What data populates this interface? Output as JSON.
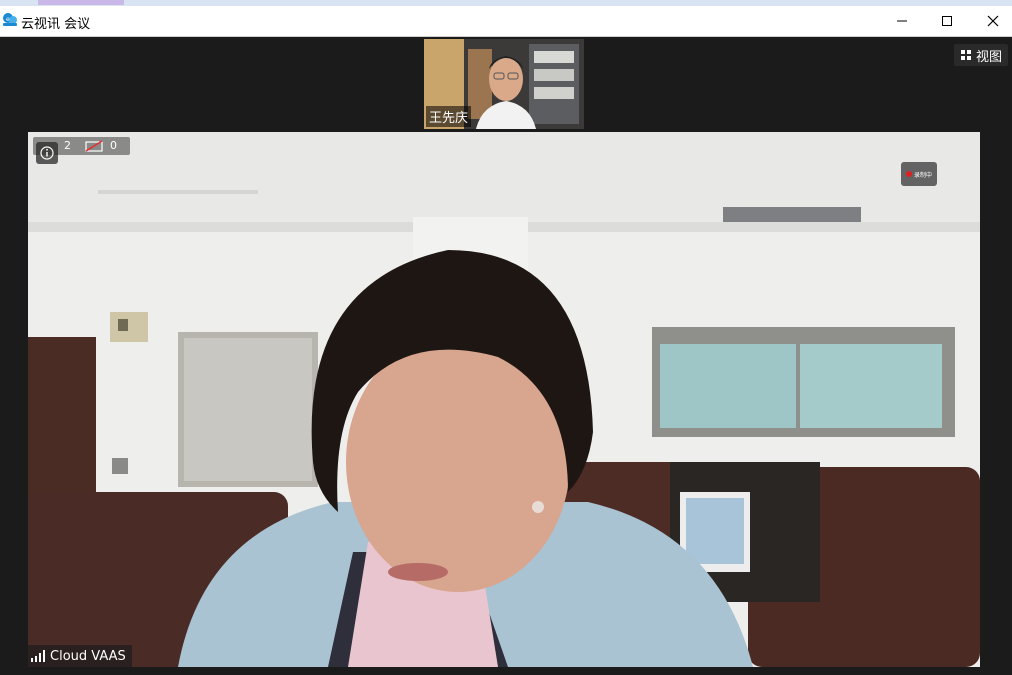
{
  "window": {
    "title": "云视讯 会议",
    "accent": "#1a8ad4"
  },
  "participants": {
    "thumbnail_name": "王先庆"
  },
  "toolbar": {
    "view_label": "视图"
  },
  "stats": {
    "participant_count": "2",
    "video_off_count": "0"
  },
  "recording": {
    "label": "录制中",
    "color": "#e02020"
  },
  "network": {
    "label": "Cloud VAAS"
  }
}
